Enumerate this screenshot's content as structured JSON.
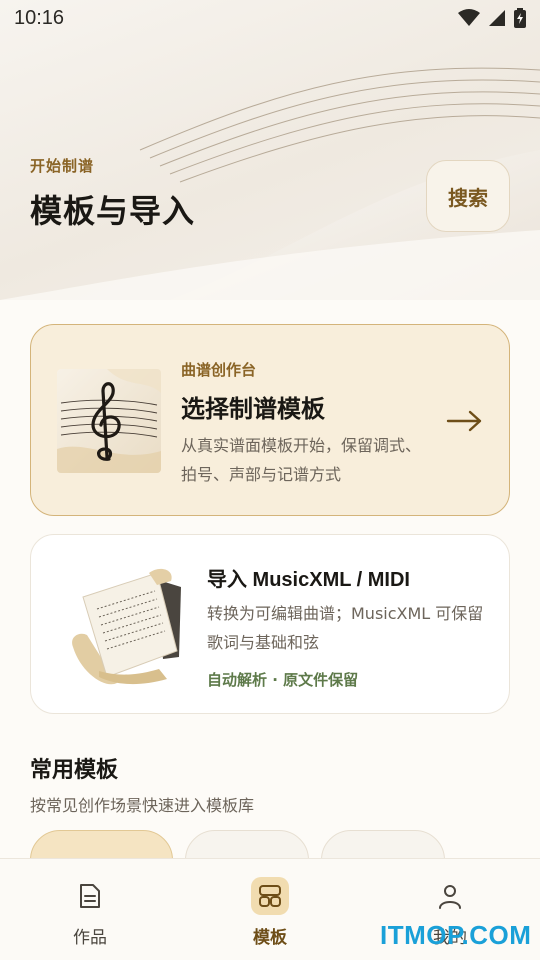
{
  "status_bar": {
    "time": "10:16"
  },
  "header": {
    "kicker": "开始制谱",
    "title": "模板与导入",
    "search_label": "搜索"
  },
  "cards": {
    "primary": {
      "eyebrow": "曲谱创作台",
      "title": "选择制谱模板",
      "description": "从真实谱面模板开始，保留调式、拍号、声部与记谱方式"
    },
    "secondary": {
      "title": "导入 MusicXML / MIDI",
      "description": "转换为可编辑曲谱；MusicXML 可保留歌词与基础和弦",
      "tag": "自动解析 · 原文件保留"
    }
  },
  "section": {
    "title": "常用模板",
    "subtitle": "按常见创作场景快速进入模板库"
  },
  "bottom_nav": {
    "items": [
      {
        "label": "作品",
        "icon": "document-icon"
      },
      {
        "label": "模板",
        "icon": "layout-grid-icon"
      },
      {
        "label": "我的",
        "icon": "person-icon"
      }
    ],
    "active_index": 1
  },
  "watermark": "ITMOP.COM",
  "colors": {
    "accent": "#8a6426",
    "primary_card_bg": "#f8eedb",
    "tag_green": "#5e7a4a"
  }
}
